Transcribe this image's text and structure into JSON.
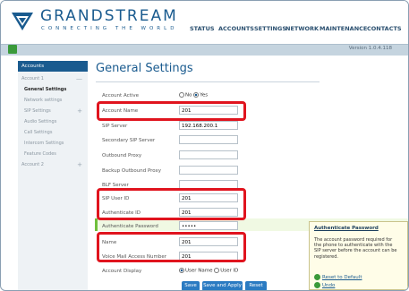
{
  "brand": {
    "name": "GRANDSTREAM",
    "tagline": "CONNECTING THE WORLD"
  },
  "nav": [
    "STATUS",
    "ACCOUNTS",
    "SETTINGS",
    "NETWORK",
    "MAINTENANCE",
    "CONTACTS"
  ],
  "version": "Version 1.0.4.118",
  "sidebar": {
    "header": "Accounts",
    "account1": "Account 1",
    "items": [
      "General Settings",
      "Network settings",
      "SIP Settings",
      "Audio Settings",
      "Call Settings",
      "Intercom Settings",
      "Feature Codes"
    ],
    "account2": "Account 2",
    "toggle_minus": "—",
    "toggle_plus": "+"
  },
  "page": {
    "title": "General Settings"
  },
  "form": {
    "account_active": {
      "label": "Account Active",
      "no": "No",
      "yes": "Yes",
      "selected": "Yes"
    },
    "account_name": {
      "label": "Account Name",
      "value": "201"
    },
    "sip_server": {
      "label": "SIP Server",
      "value": "192.168.200.1"
    },
    "secondary_sip_server": {
      "label": "Secondary SIP Server",
      "value": ""
    },
    "outbound_proxy": {
      "label": "Outbound Proxy",
      "value": ""
    },
    "backup_outbound_proxy": {
      "label": "Backup Outbound Proxy",
      "value": ""
    },
    "blf_server": {
      "label": "BLF Server",
      "value": ""
    },
    "sip_user_id": {
      "label": "SIP User ID",
      "value": "201"
    },
    "authenticate_id": {
      "label": "Authenticate ID",
      "value": "201"
    },
    "authenticate_password": {
      "label": "Authenticate Password",
      "value": "•••••"
    },
    "name": {
      "label": "Name",
      "value": "201"
    },
    "voice_mail_access_number": {
      "label": "Voice Mail Access Number",
      "value": "201"
    },
    "account_display": {
      "label": "Account Display",
      "user_name": "User Name",
      "user_id": "User ID",
      "selected": "User Name"
    }
  },
  "help": {
    "title": "Authenticate Password",
    "body": "The account password required for the phone to authenticate with the SIP server before the account can be registered.",
    "reset": "Reset to Default",
    "undo": "Undo"
  },
  "buttons": {
    "save": "Save",
    "save_apply": "Save and Apply",
    "reset": "Reset"
  },
  "colors": {
    "accent": "#1a5b8f",
    "highlight": "#e0141e",
    "button": "#2b7bc2"
  }
}
